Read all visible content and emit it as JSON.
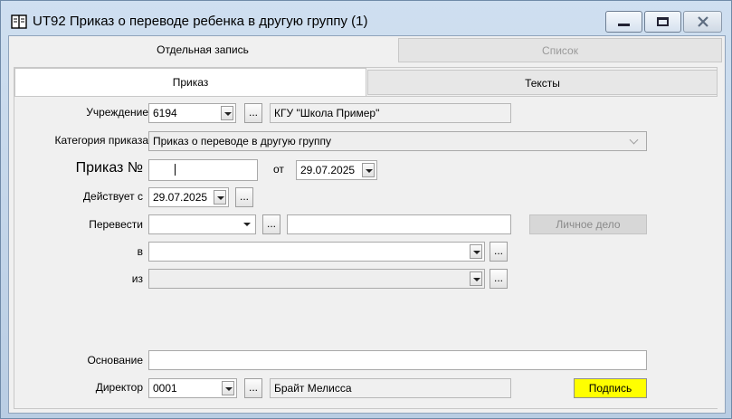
{
  "window": {
    "title": "UT92 Приказ о переводе ребенка в другую группу (1)",
    "icon": "book-icon"
  },
  "outer_tabs": [
    {
      "label": "Отдельная запись",
      "active": true
    },
    {
      "label": "Список",
      "active": false
    }
  ],
  "inner_tabs": [
    {
      "label": "Приказ",
      "active": true
    },
    {
      "label": "Тексты",
      "active": false
    }
  ],
  "form": {
    "institution": {
      "label": "Учреждение",
      "code": "6194",
      "ellipsis": "...",
      "name": "КГУ \"Школа Пример\""
    },
    "category": {
      "label": "Категория приказа",
      "value": "Приказ о переводе в другую группу"
    },
    "order": {
      "label": "Приказ №",
      "number": "",
      "date_label": "от",
      "date": "29.07.2025"
    },
    "effective": {
      "label": "Действует с",
      "date": "29.07.2025",
      "ellipsis": "..."
    },
    "transfer": {
      "label": "Перевести",
      "value": "",
      "ellipsis": "...",
      "name": "",
      "personal_file_button": "Личное дело"
    },
    "to_group": {
      "label": "в",
      "value": "",
      "ellipsis": "..."
    },
    "from_group": {
      "label": "из",
      "value": "",
      "ellipsis": "..."
    },
    "basis": {
      "label": "Основание",
      "value": ""
    },
    "director": {
      "label": "Директор",
      "code": "0001",
      "ellipsis": "...",
      "name": "Брайт Мелисса",
      "sign_button": "Подпись"
    }
  },
  "colors": {
    "sign_button": "#ffff00",
    "window_frame": "#b9cde3",
    "form_background": "#f0f0f0"
  }
}
